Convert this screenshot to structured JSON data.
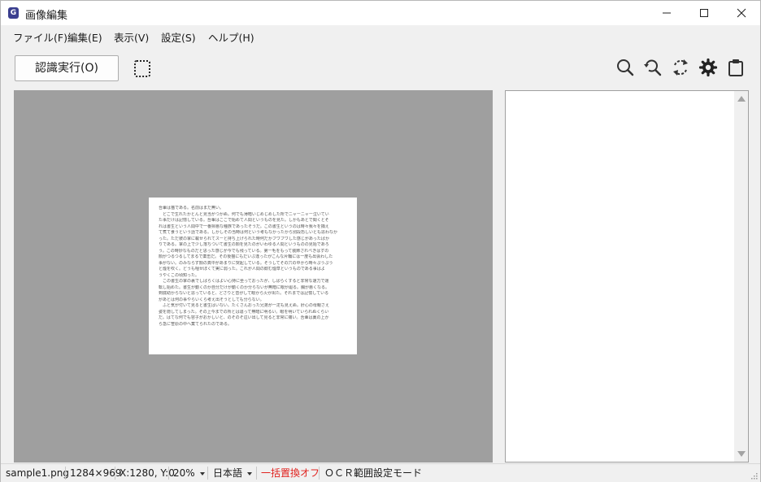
{
  "window": {
    "title": "画像編集",
    "app_icon_letter": "G"
  },
  "menu": {
    "items": [
      "ファイル(F)",
      "編集(E)",
      "表示(V)",
      "設定(S)",
      "ヘルプ(H)"
    ]
  },
  "toolbar": {
    "run_label": "認識実行(O)",
    "icons": [
      "select-area-icon",
      "search-icon",
      "search-replace-icon",
      "rotate-icon",
      "settings-icon",
      "clipboard-icon"
    ]
  },
  "document": {
    "lines": [
      "吾輩は猫である。名前はまだ無い。",
      "　どこで生れたかとんと見当がつかぬ。何でも薄暗いじめじめした所でニャーニャー泣いてい",
      "た事だけは記憶している。吾輩はここで始めて人間というものを見た。しかもあとで聞くとそ",
      "れは書生という人間中で一番獰悪な種族であったそうだ。この書生というのは時々我々を捕え",
      "て煮て食うという話である。しかしその当時は何という考もなかったから別段恐しいとも思わなか",
      "った。ただ彼の掌に載せられてスーと持ち上げられた時何だかフワフワした感じがあったばか",
      "りである。掌の上で少し落ちついて書生の顔を見たのがいわゆる人間というものの見始であろ",
      "う。この時妙なものだと思った感じが今でも残っている。第一毛をもって装飾されべきはずの",
      "顔がつるつるしてまるで薬缶だ。その後猫にもだいぶ逢ったがこんな片輪には一度も出会わした",
      "事がない。のみならず顔の真中があまりに突起している。そうしてその穴の中から時々ぷうぷう",
      "と煙を吹く。どうも咽せぽくて実に弱った。これが人間の飲む煙草というものである事はよ",
      "うやくこの頃知った。",
      "　この書生の掌の裏でしばらくはよい心持に坐っておったが、しばらくすると非常な速力で運",
      "転し始めた。書生が動くのか自分だけが動くのか分らないが無暗に眼が廻る。胸が悪くなる。",
      "到底助からないと思っていると、どさりと音がして眼から火が出た。それまでは記憶している",
      "があとは何の事やらいくら考え出そうとしても分らない。",
      "　ふと気が付いて見ると書生はいない。たくさんおった兄弟が一疋も見えぬ。肝心の母親さえ",
      "姿を隠してしまった。その上今までの所とは違って無暗に明るい。眼を明いていられぬくらい",
      "だ。はてな何でも容子がおかしいと、のそのそ這い出して見ると非常に痛い。吾輩は藁の上か",
      "ら急に笹原の中へ棄てられたのである。"
    ]
  },
  "status": {
    "filename": "sample1.png",
    "dimensions": "1284×969",
    "coords": "X:1280, Y:0",
    "zoom": "20%",
    "language": "日本語",
    "replace_state": "一括置換オフ",
    "mode": "ＯＣＲ範囲設定モード"
  },
  "colors": {
    "replace_state": "#e0201c",
    "canvas_bg": "#9f9f9f"
  }
}
